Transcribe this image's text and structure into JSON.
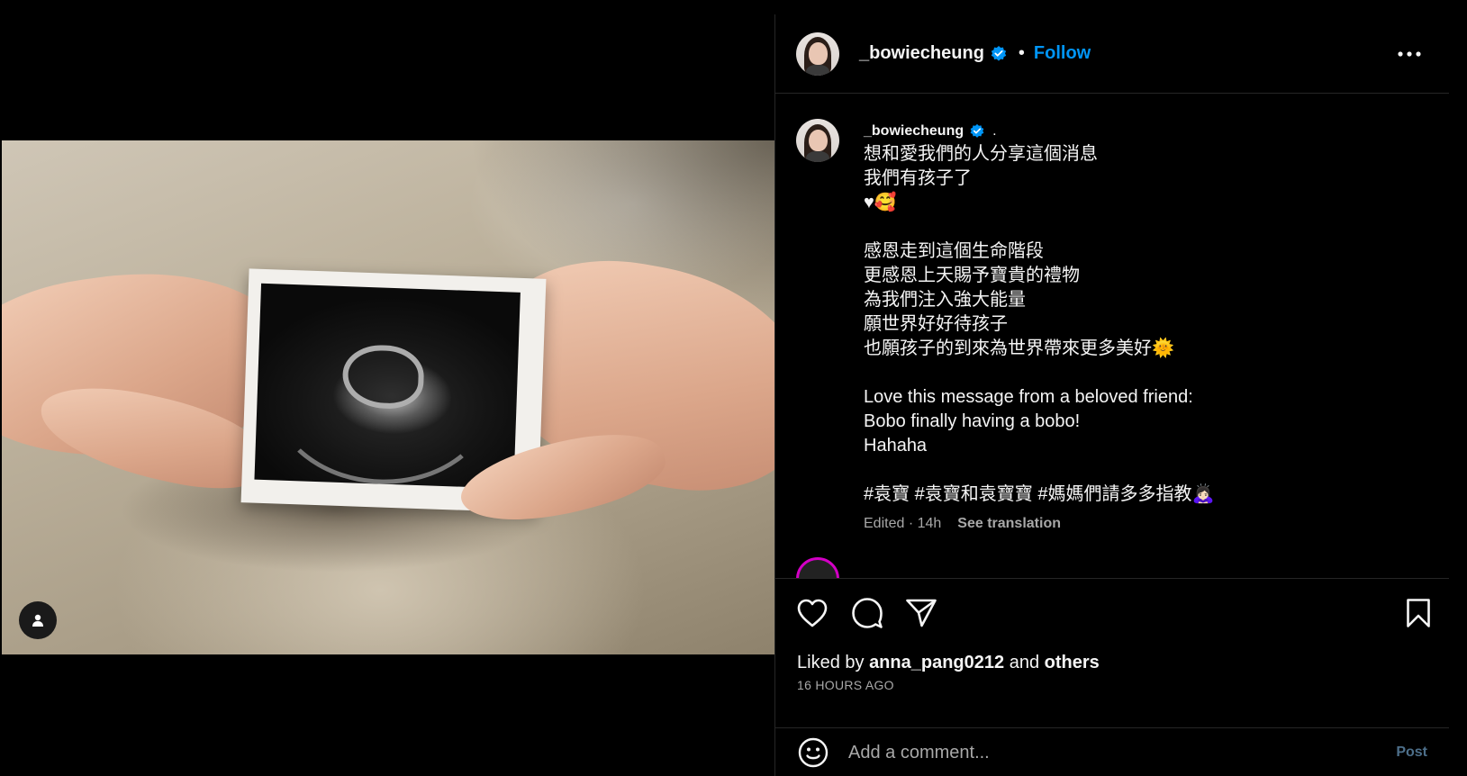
{
  "post": {
    "username": "_bowiecheung",
    "header_separator": "•",
    "follow_label": "Follow",
    "caption_user": "_bowiecheung",
    "caption_user_suffix": ".",
    "caption_text": "想和愛我們的人分享這個消息\n我們有孩子了\n♥🥰\n\n感恩走到這個生命階段\n更感恩上天賜予寶貴的禮物\n為我們注入強大能量\n願世界好好待孩子\n也願孩子的到來為世界帶來更多美好🌞\n\nLove this message from a beloved friend:\nBobo finally having a bobo!\nHahaha\n\n#袁寶 #袁寶和袁寶寶 #媽媽們請多多指教🙇🏻‍♀️",
    "edited_time": "Edited · 14h",
    "see_translation": "See translation",
    "liked_prefix": "Liked by",
    "liked_user": "anna_pang0212",
    "liked_and": "and",
    "liked_others": "others",
    "posted_ago": "16 HOURS AGO"
  },
  "comment_box": {
    "placeholder": "Add a comment...",
    "post_label": "Post"
  },
  "colors": {
    "background": "#000000",
    "accent": "#0095f6",
    "muted": "#a8a8a8",
    "divider": "#262626"
  },
  "icons": {
    "verified": "verified-badge-icon",
    "more": "more-options-icon",
    "like": "heart-icon",
    "comment": "comment-bubble-icon",
    "share": "paper-plane-icon",
    "save": "bookmark-icon",
    "emoji": "emoji-icon",
    "tag": "user-tag-icon"
  }
}
